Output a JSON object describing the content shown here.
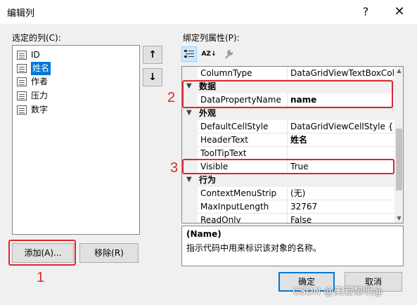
{
  "window": {
    "title": "编辑列",
    "help": "?",
    "close": "✕"
  },
  "left": {
    "label": "选定的列(C):",
    "columns": [
      "ID",
      "姓名",
      "作者",
      "压力",
      "数字"
    ],
    "selected_index": 1,
    "move_up": "↑",
    "move_down": "↓",
    "add_button": "添加(A)...",
    "remove_button": "移除(R)"
  },
  "right": {
    "label": "绑定列属性(P):",
    "toolbar": {
      "categorized": "categorized-icon",
      "alphabetical": "AZ↓",
      "property_pages": "wrench-icon"
    },
    "rows": [
      {
        "type": "prop",
        "name": "ColumnType",
        "value": "DataGridViewTextBoxColu",
        "bold": false
      },
      {
        "type": "cat",
        "name": "数据"
      },
      {
        "type": "prop",
        "name": "DataPropertyName",
        "value": "name",
        "bold": true
      },
      {
        "type": "cat",
        "name": "外观"
      },
      {
        "type": "prop",
        "name": "DefaultCellStyle",
        "value": "DataGridViewCellStyle { }",
        "bold": false
      },
      {
        "type": "prop",
        "name": "HeaderText",
        "value": "姓名",
        "bold": true
      },
      {
        "type": "prop",
        "name": "ToolTipText",
        "value": "",
        "bold": false
      },
      {
        "type": "prop",
        "name": "Visible",
        "value": "True",
        "bold": false
      },
      {
        "type": "cat",
        "name": "行为"
      },
      {
        "type": "prop",
        "name": "ContextMenuStrip",
        "value": "(无)",
        "bold": false
      },
      {
        "type": "prop",
        "name": "MaxInputLength",
        "value": "32767",
        "bold": false
      },
      {
        "type": "prop",
        "name": "ReadOnly",
        "value": "False",
        "bold": false
      }
    ],
    "description": {
      "title": "(Name)",
      "text": "指示代码中用来标识该对象的名称。"
    }
  },
  "buttons": {
    "ok": "确定",
    "cancel": "取消"
  },
  "annotations": {
    "one": "1",
    "two": "2",
    "three": "3",
    "color": "#e0262d"
  },
  "watermark": "CSDN @美若黎明@"
}
